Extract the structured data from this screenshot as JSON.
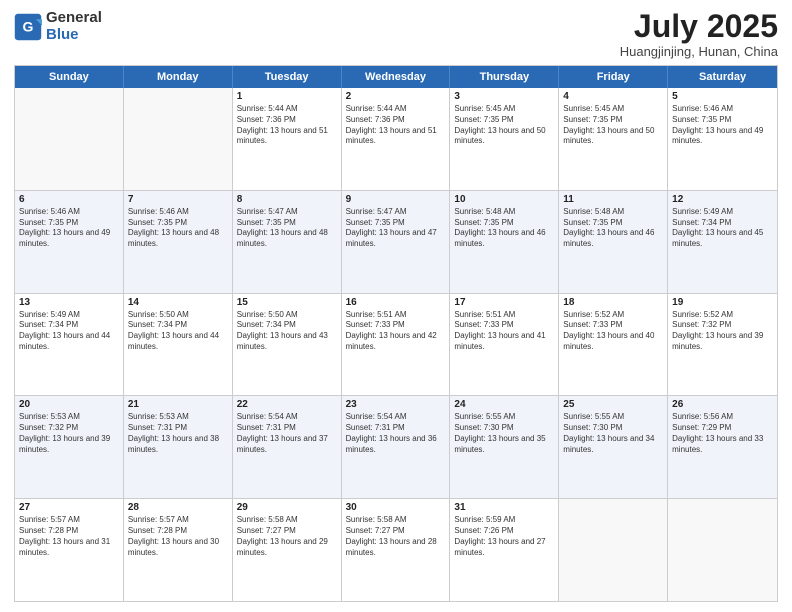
{
  "header": {
    "logo": {
      "general": "General",
      "blue": "Blue"
    },
    "title": "July 2025",
    "location": "Huangjinjing, Hunan, China"
  },
  "calendar": {
    "days": [
      "Sunday",
      "Monday",
      "Tuesday",
      "Wednesday",
      "Thursday",
      "Friday",
      "Saturday"
    ],
    "rows": [
      [
        {
          "day": "",
          "sunrise": "",
          "sunset": "",
          "daylight": "",
          "empty": true
        },
        {
          "day": "",
          "sunrise": "",
          "sunset": "",
          "daylight": "",
          "empty": true
        },
        {
          "day": "1",
          "sunrise": "Sunrise: 5:44 AM",
          "sunset": "Sunset: 7:36 PM",
          "daylight": "Daylight: 13 hours and 51 minutes.",
          "empty": false
        },
        {
          "day": "2",
          "sunrise": "Sunrise: 5:44 AM",
          "sunset": "Sunset: 7:36 PM",
          "daylight": "Daylight: 13 hours and 51 minutes.",
          "empty": false
        },
        {
          "day": "3",
          "sunrise": "Sunrise: 5:45 AM",
          "sunset": "Sunset: 7:35 PM",
          "daylight": "Daylight: 13 hours and 50 minutes.",
          "empty": false
        },
        {
          "day": "4",
          "sunrise": "Sunrise: 5:45 AM",
          "sunset": "Sunset: 7:35 PM",
          "daylight": "Daylight: 13 hours and 50 minutes.",
          "empty": false
        },
        {
          "day": "5",
          "sunrise": "Sunrise: 5:46 AM",
          "sunset": "Sunset: 7:35 PM",
          "daylight": "Daylight: 13 hours and 49 minutes.",
          "empty": false
        }
      ],
      [
        {
          "day": "6",
          "sunrise": "Sunrise: 5:46 AM",
          "sunset": "Sunset: 7:35 PM",
          "daylight": "Daylight: 13 hours and 49 minutes.",
          "empty": false
        },
        {
          "day": "7",
          "sunrise": "Sunrise: 5:46 AM",
          "sunset": "Sunset: 7:35 PM",
          "daylight": "Daylight: 13 hours and 48 minutes.",
          "empty": false
        },
        {
          "day": "8",
          "sunrise": "Sunrise: 5:47 AM",
          "sunset": "Sunset: 7:35 PM",
          "daylight": "Daylight: 13 hours and 48 minutes.",
          "empty": false
        },
        {
          "day": "9",
          "sunrise": "Sunrise: 5:47 AM",
          "sunset": "Sunset: 7:35 PM",
          "daylight": "Daylight: 13 hours and 47 minutes.",
          "empty": false
        },
        {
          "day": "10",
          "sunrise": "Sunrise: 5:48 AM",
          "sunset": "Sunset: 7:35 PM",
          "daylight": "Daylight: 13 hours and 46 minutes.",
          "empty": false
        },
        {
          "day": "11",
          "sunrise": "Sunrise: 5:48 AM",
          "sunset": "Sunset: 7:35 PM",
          "daylight": "Daylight: 13 hours and 46 minutes.",
          "empty": false
        },
        {
          "day": "12",
          "sunrise": "Sunrise: 5:49 AM",
          "sunset": "Sunset: 7:34 PM",
          "daylight": "Daylight: 13 hours and 45 minutes.",
          "empty": false
        }
      ],
      [
        {
          "day": "13",
          "sunrise": "Sunrise: 5:49 AM",
          "sunset": "Sunset: 7:34 PM",
          "daylight": "Daylight: 13 hours and 44 minutes.",
          "empty": false
        },
        {
          "day": "14",
          "sunrise": "Sunrise: 5:50 AM",
          "sunset": "Sunset: 7:34 PM",
          "daylight": "Daylight: 13 hours and 44 minutes.",
          "empty": false
        },
        {
          "day": "15",
          "sunrise": "Sunrise: 5:50 AM",
          "sunset": "Sunset: 7:34 PM",
          "daylight": "Daylight: 13 hours and 43 minutes.",
          "empty": false
        },
        {
          "day": "16",
          "sunrise": "Sunrise: 5:51 AM",
          "sunset": "Sunset: 7:33 PM",
          "daylight": "Daylight: 13 hours and 42 minutes.",
          "empty": false
        },
        {
          "day": "17",
          "sunrise": "Sunrise: 5:51 AM",
          "sunset": "Sunset: 7:33 PM",
          "daylight": "Daylight: 13 hours and 41 minutes.",
          "empty": false
        },
        {
          "day": "18",
          "sunrise": "Sunrise: 5:52 AM",
          "sunset": "Sunset: 7:33 PM",
          "daylight": "Daylight: 13 hours and 40 minutes.",
          "empty": false
        },
        {
          "day": "19",
          "sunrise": "Sunrise: 5:52 AM",
          "sunset": "Sunset: 7:32 PM",
          "daylight": "Daylight: 13 hours and 39 minutes.",
          "empty": false
        }
      ],
      [
        {
          "day": "20",
          "sunrise": "Sunrise: 5:53 AM",
          "sunset": "Sunset: 7:32 PM",
          "daylight": "Daylight: 13 hours and 39 minutes.",
          "empty": false
        },
        {
          "day": "21",
          "sunrise": "Sunrise: 5:53 AM",
          "sunset": "Sunset: 7:31 PM",
          "daylight": "Daylight: 13 hours and 38 minutes.",
          "empty": false
        },
        {
          "day": "22",
          "sunrise": "Sunrise: 5:54 AM",
          "sunset": "Sunset: 7:31 PM",
          "daylight": "Daylight: 13 hours and 37 minutes.",
          "empty": false
        },
        {
          "day": "23",
          "sunrise": "Sunrise: 5:54 AM",
          "sunset": "Sunset: 7:31 PM",
          "daylight": "Daylight: 13 hours and 36 minutes.",
          "empty": false
        },
        {
          "day": "24",
          "sunrise": "Sunrise: 5:55 AM",
          "sunset": "Sunset: 7:30 PM",
          "daylight": "Daylight: 13 hours and 35 minutes.",
          "empty": false
        },
        {
          "day": "25",
          "sunrise": "Sunrise: 5:55 AM",
          "sunset": "Sunset: 7:30 PM",
          "daylight": "Daylight: 13 hours and 34 minutes.",
          "empty": false
        },
        {
          "day": "26",
          "sunrise": "Sunrise: 5:56 AM",
          "sunset": "Sunset: 7:29 PM",
          "daylight": "Daylight: 13 hours and 33 minutes.",
          "empty": false
        }
      ],
      [
        {
          "day": "27",
          "sunrise": "Sunrise: 5:57 AM",
          "sunset": "Sunset: 7:28 PM",
          "daylight": "Daylight: 13 hours and 31 minutes.",
          "empty": false
        },
        {
          "day": "28",
          "sunrise": "Sunrise: 5:57 AM",
          "sunset": "Sunset: 7:28 PM",
          "daylight": "Daylight: 13 hours and 30 minutes.",
          "empty": false
        },
        {
          "day": "29",
          "sunrise": "Sunrise: 5:58 AM",
          "sunset": "Sunset: 7:27 PM",
          "daylight": "Daylight: 13 hours and 29 minutes.",
          "empty": false
        },
        {
          "day": "30",
          "sunrise": "Sunrise: 5:58 AM",
          "sunset": "Sunset: 7:27 PM",
          "daylight": "Daylight: 13 hours and 28 minutes.",
          "empty": false
        },
        {
          "day": "31",
          "sunrise": "Sunrise: 5:59 AM",
          "sunset": "Sunset: 7:26 PM",
          "daylight": "Daylight: 13 hours and 27 minutes.",
          "empty": false
        },
        {
          "day": "",
          "sunrise": "",
          "sunset": "",
          "daylight": "",
          "empty": true
        },
        {
          "day": "",
          "sunrise": "",
          "sunset": "",
          "daylight": "",
          "empty": true
        }
      ]
    ]
  }
}
